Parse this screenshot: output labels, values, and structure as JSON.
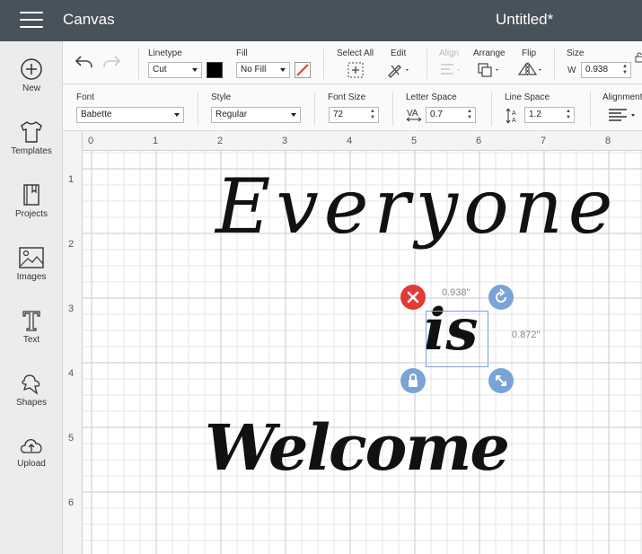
{
  "header": {
    "app_title": "Canvas",
    "doc_title": "Untitled*"
  },
  "sidebar": {
    "items": [
      {
        "label": "New",
        "icon": "plus-circle-icon"
      },
      {
        "label": "Templates",
        "icon": "shirt-icon"
      },
      {
        "label": "Projects",
        "icon": "book-icon"
      },
      {
        "label": "Images",
        "icon": "image-icon"
      },
      {
        "label": "Text",
        "icon": "text-t-icon"
      },
      {
        "label": "Shapes",
        "icon": "shapes-icon"
      },
      {
        "label": "Upload",
        "icon": "cloud-upload-icon"
      }
    ]
  },
  "toolbar1": {
    "linetype_label": "Linetype",
    "linetype_value": "Cut",
    "fill_label": "Fill",
    "fill_value": "No Fill",
    "fill_color": "#000000",
    "select_all_label": "Select All",
    "edit_label": "Edit",
    "align_label": "Align",
    "arrange_label": "Arrange",
    "flip_label": "Flip",
    "size_label": "Size",
    "size_w_label": "W",
    "size_w_value": "0.938"
  },
  "toolbar2": {
    "font_label": "Font",
    "font_value": "Babette",
    "style_label": "Style",
    "style_value": "Regular",
    "font_size_label": "Font Size",
    "font_size_value": "72",
    "letter_space_label": "Letter Space",
    "letter_space_value": "0.7",
    "line_space_label": "Line Space",
    "line_space_value": "1.2",
    "alignment_label": "Alignment"
  },
  "canvas": {
    "ruler_top": [
      "0",
      "1",
      "2",
      "3",
      "4",
      "5",
      "6",
      "7",
      "8"
    ],
    "ruler_left": [
      "1",
      "2",
      "3",
      "4",
      "5",
      "6"
    ],
    "texts": {
      "line1": "Everyone",
      "line2": "is",
      "line3": "Welcome"
    },
    "selection": {
      "width_label": "0.938\"",
      "height_label": "0.872\""
    }
  },
  "colors": {
    "topbar": "#48525b",
    "delete_handle": "#e53935",
    "handle_blue": "#7aa3d6",
    "selection_border": "#7aa3d6"
  }
}
